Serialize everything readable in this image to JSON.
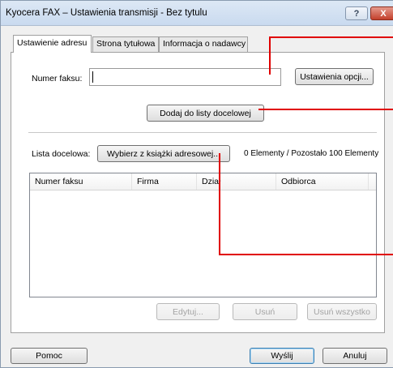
{
  "window": {
    "title": "Kyocera FAX – Ustawienia transmisji - Bez tytulu",
    "help_button": "?",
    "close_button": "X"
  },
  "tabs": [
    {
      "label": "Ustawienie adresu",
      "active": true
    },
    {
      "label": "Strona tytułowa",
      "active": false
    },
    {
      "label": "Informacja o nadawcy",
      "active": false
    }
  ],
  "fax_section": {
    "fax_label": "Numer faksu:",
    "fax_value": "",
    "options_button": "Ustawienia opcji...",
    "add_button": "Dodaj do listy docelowej"
  },
  "destination": {
    "label": "Lista docelowa:",
    "address_book_button": "Wybierz z książki adresowej...",
    "status": "0 Elementy / Pozostało 100 Elementy",
    "columns": [
      "Numer faksu",
      "Firma",
      "Dział",
      "Odbiorca"
    ],
    "rows": [],
    "edit_button": "Edytuj...",
    "delete_button": "Usuń",
    "delete_all_button": "Usuń wszystko"
  },
  "footer": {
    "help_button": "Pomoc",
    "send_button": "Wyślij",
    "cancel_button": "Anuluj"
  },
  "colors": {
    "callout": "#e00000",
    "close_button": "#c3402c"
  }
}
